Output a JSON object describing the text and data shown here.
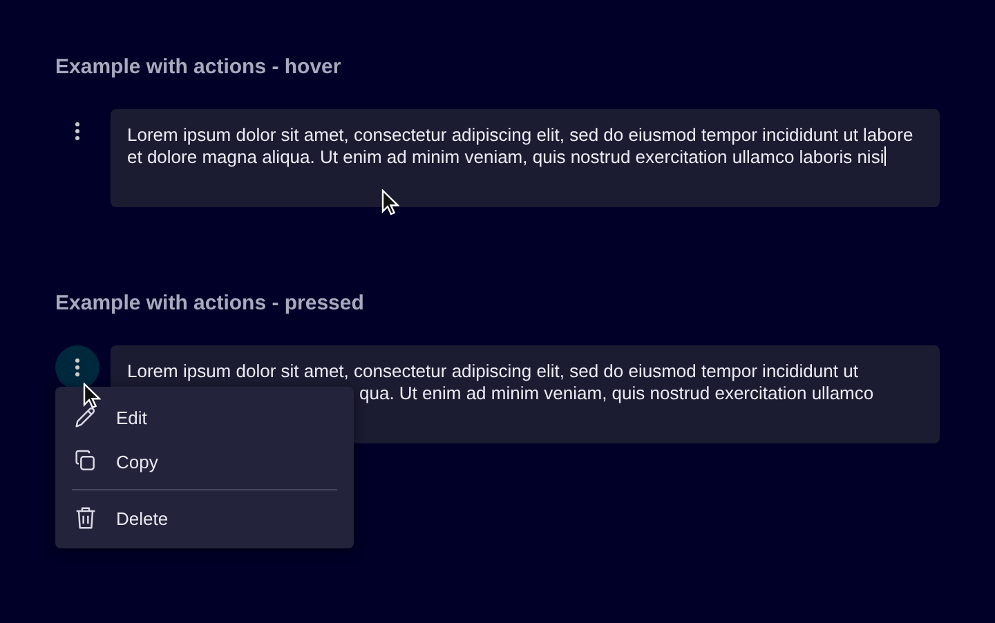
{
  "sections": [
    {
      "title": "Example with actions - hover",
      "text": "Lorem ipsum dolor sit amet, consectetur adipiscing elit, sed do eiusmod tempor incididunt ut labore et dolore magna aliqua. Ut enim ad minim veniam, quis nostrud exercitation ullamco laboris nisi",
      "focused": true,
      "menu_open": false
    },
    {
      "title": "Example with actions - pressed",
      "lines": [
        "Lorem ipsum dolor sit amet, consectetur adipiscing elit, sed do eiusmod tempor incididunt ut",
        "qua. Ut enim ad minim veniam, quis nostrud exercitation ullamco"
      ],
      "focused": false,
      "menu_open": true,
      "menu": [
        {
          "kind": "edit",
          "label": "Edit"
        },
        {
          "kind": "copy",
          "label": "Copy"
        },
        {
          "kind": "divider"
        },
        {
          "kind": "delete",
          "label": "Delete"
        }
      ]
    }
  ]
}
